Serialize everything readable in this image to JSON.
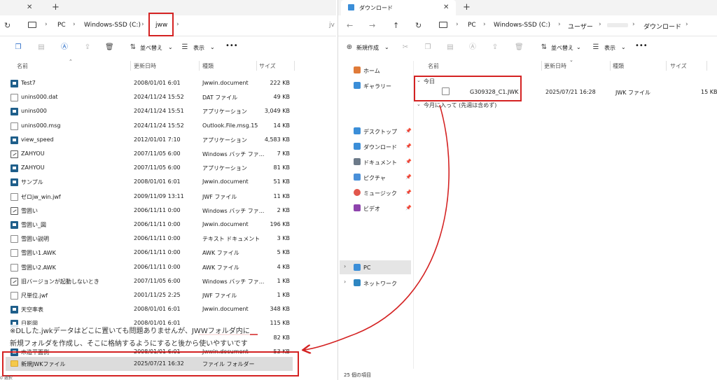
{
  "left_window": {
    "address": {
      "pc": "PC",
      "drive": "Windows-SSD (C:)",
      "folder": "jww",
      "cut": "jv"
    },
    "toolbar": {
      "sort": "並べ替え",
      "view": "表示",
      "more": "•••"
    },
    "headers": {
      "name": "名前",
      "modified": "更新日時",
      "type": "種類",
      "size": "サイズ"
    },
    "files": [
      {
        "name": "Test7",
        "date": "2008/01/01 6:01",
        "type": "Jwwin.document",
        "size": "222 KB",
        "icon": "app"
      },
      {
        "name": "unins000.dat",
        "date": "2024/11/24 15:52",
        "type": "DAT ファイル",
        "size": "49 KB",
        "icon": "doc"
      },
      {
        "name": "unins000",
        "date": "2024/11/24 15:51",
        "type": "アプリケーション",
        "size": "3,049 KB",
        "icon": "app"
      },
      {
        "name": "unins000.msg",
        "date": "2024/11/24 15:52",
        "type": "Outlook.File.msg.15",
        "size": "14 KB",
        "icon": "doc"
      },
      {
        "name": "view_speed",
        "date": "2012/01/01 7:10",
        "type": "アプリケーション",
        "size": "4,583 KB",
        "icon": "app"
      },
      {
        "name": "ZAHYOU",
        "date": "2007/11/05 6:00",
        "type": "Windows バッチ ファ...",
        "size": "7 KB",
        "icon": "patch"
      },
      {
        "name": "ZAHYOU",
        "date": "2007/11/05 6:00",
        "type": "アプリケーション",
        "size": "81 KB",
        "icon": "app"
      },
      {
        "name": "サンプル",
        "date": "2008/01/01 6:01",
        "type": "Jwwin.document",
        "size": "51 KB",
        "icon": "app"
      },
      {
        "name": "ゼロjw_win.jwf",
        "date": "2009/11/09 13:11",
        "type": "JWF ファイル",
        "size": "11 KB",
        "icon": "doc"
      },
      {
        "name": "雪囲い",
        "date": "2006/11/11 0:00",
        "type": "Windows バッチ ファ...",
        "size": "2 KB",
        "icon": "patch"
      },
      {
        "name": "雪囲い_図",
        "date": "2006/11/11 0:00",
        "type": "Jwwin.document",
        "size": "196 KB",
        "icon": "app"
      },
      {
        "name": "雪囲い説明",
        "date": "2006/11/11 0:00",
        "type": "テキスト ドキュメント",
        "size": "3 KB",
        "icon": "doc"
      },
      {
        "name": "雪囲い1.AWK",
        "date": "2006/11/11 0:00",
        "type": "AWK ファイル",
        "size": "5 KB",
        "icon": "doc"
      },
      {
        "name": "雪囲い2.AWK",
        "date": "2006/11/11 0:00",
        "type": "AWK ファイル",
        "size": "4 KB",
        "icon": "doc"
      },
      {
        "name": "旧バージョンが起動しないとき",
        "date": "2007/11/05 6:00",
        "type": "Windows バッチ ファ...",
        "size": "1 KB",
        "icon": "patch"
      },
      {
        "name": "尺単位.jwf",
        "date": "2001/11/25 2:25",
        "type": "JWF ファイル",
        "size": "1 KB",
        "icon": "doc"
      },
      {
        "name": "天空率表",
        "date": "2008/01/01 6:01",
        "type": "Jwwin.document",
        "size": "348 KB",
        "icon": "app"
      },
      {
        "name": "日影図",
        "date": "2008/01/01 6:01",
        "type": "",
        "size": "115 KB",
        "icon": "app"
      },
      {
        "name": "",
        "date": "",
        "type": "",
        "size": "82 KB",
        "icon": ""
      },
      {
        "name": "木造平面例",
        "date": "2008/01/01 6:01",
        "type": "Jwwin.document",
        "size": "53 KB",
        "icon": "app"
      }
    ],
    "new_folder": {
      "name": "新規JWKファイル",
      "date": "2025/07/21 16:32",
      "type": "ファイル フォルダー"
    },
    "status": "0 選択"
  },
  "right_window": {
    "tab_title": "ダウンロード",
    "address": {
      "pc": "PC",
      "drive": "Windows-SSD (C:)",
      "users": "ユーザー",
      "downloads": "ダウンロード"
    },
    "toolbar": {
      "new": "新規作成",
      "sort": "並べ替え",
      "view": "表示",
      "more": "•••"
    },
    "headers": {
      "name": "名前",
      "modified": "更新日時",
      "type": "種類",
      "size": "サイズ"
    },
    "nav": {
      "home": "ホーム",
      "gallery": "ギャラリー",
      "desktop": "デスクトップ",
      "downloads": "ダウンロード",
      "documents": "ドキュメント",
      "pictures": "ピクチャ",
      "music": "ミュージック",
      "videos": "ビデオ",
      "pc": "PC",
      "network": "ネットワーク"
    },
    "groups": {
      "today": "今日",
      "this_month": "今月に入って (先週は含めず)"
    },
    "file": {
      "name": "G309328_C1.JWK",
      "date": "2025/07/21 16:28",
      "type": "JWK ファイル",
      "size": "15 KB"
    },
    "status": "25 個の項目"
  },
  "annotation": {
    "line1": "※DLした.jwkデータはどこに置いても問題ありませんが、JWWフォルダ内に",
    "line2": "新規フォルダを作成し、そこに格納するようにすると後から使いやすいです",
    "color": "#d42222"
  }
}
